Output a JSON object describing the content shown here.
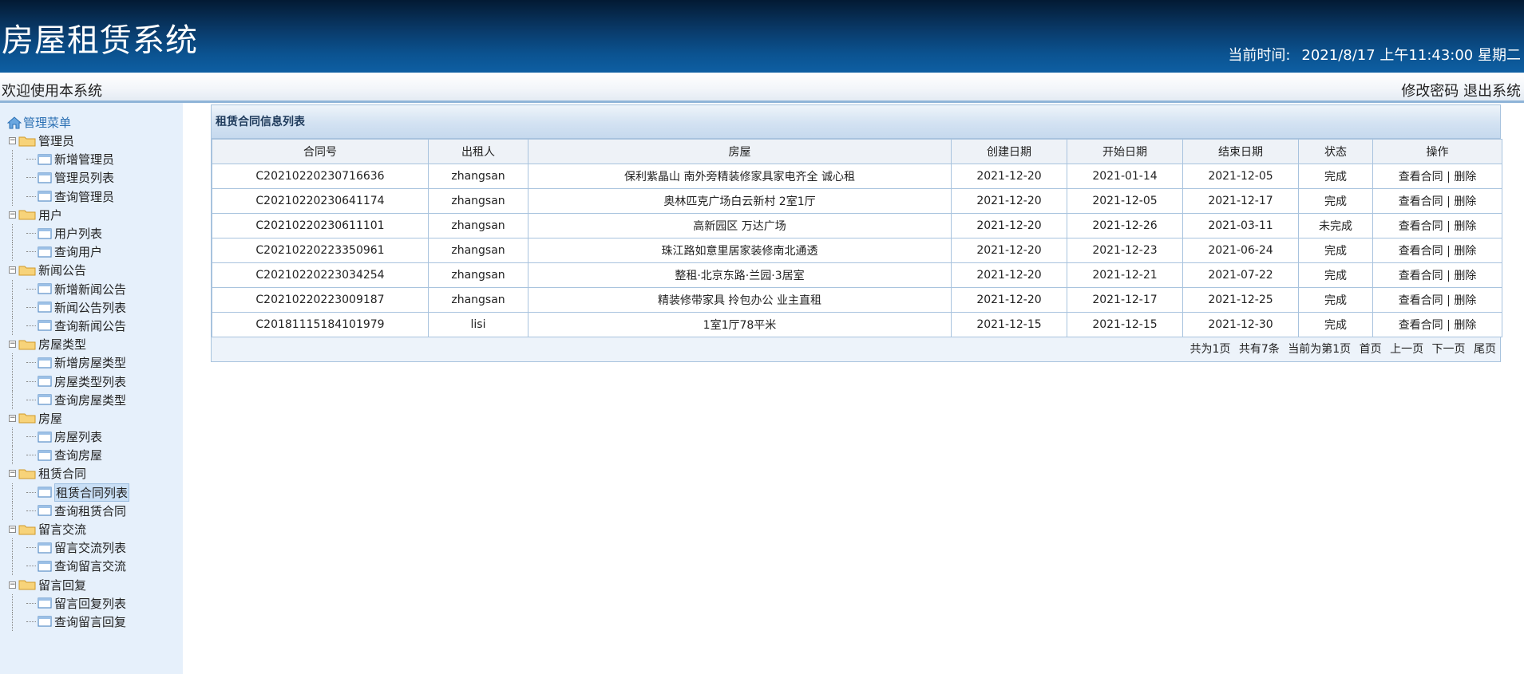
{
  "header": {
    "title": "房屋租赁系统",
    "clock_label": "当前时间:",
    "clock_value": "2021/8/17 上午11:43:00 星期二"
  },
  "bar": {
    "welcome": "欢迎使用本系统",
    "change_password": "修改密码",
    "logout": "退出系统"
  },
  "sidebar": {
    "root": "管理菜单",
    "groups": [
      {
        "label": "管理员",
        "items": [
          "新增管理员",
          "管理员列表",
          "查询管理员"
        ]
      },
      {
        "label": "用户",
        "items": [
          "用户列表",
          "查询用户"
        ]
      },
      {
        "label": "新闻公告",
        "items": [
          "新增新闻公告",
          "新闻公告列表",
          "查询新闻公告"
        ]
      },
      {
        "label": "房屋类型",
        "items": [
          "新增房屋类型",
          "房屋类型列表",
          "查询房屋类型"
        ]
      },
      {
        "label": "房屋",
        "items": [
          "房屋列表",
          "查询房屋"
        ]
      },
      {
        "label": "租赁合同",
        "items": [
          "租赁合同列表",
          "查询租赁合同"
        ]
      },
      {
        "label": "留言交流",
        "items": [
          "留言交流列表",
          "查询留言交流"
        ]
      },
      {
        "label": "留言回复",
        "items": [
          "留言回复列表",
          "查询留言回复"
        ]
      }
    ],
    "selected": "租赁合同列表"
  },
  "panel": {
    "title": "租赁合同信息列表",
    "columns": [
      "合同号",
      "出租人",
      "房屋",
      "创建日期",
      "开始日期",
      "结束日期",
      "状态",
      "操作"
    ],
    "rows": [
      [
        "C20210220230716636",
        "zhangsan",
        "保利紫晶山 南外旁精装修家具家电齐全 诚心租",
        "2021-12-20",
        "2021-01-14",
        "2021-12-05",
        "完成"
      ],
      [
        "C20210220230641174",
        "zhangsan",
        "奥林匹克广场白云新村 2室1厅",
        "2021-12-20",
        "2021-12-05",
        "2021-12-17",
        "完成"
      ],
      [
        "C20210220230611101",
        "zhangsan",
        "高新园区 万达广场",
        "2021-12-20",
        "2021-12-26",
        "2021-03-11",
        "未完成"
      ],
      [
        "C20210220223350961",
        "zhangsan",
        "珠江路如意里居家装修南北通透",
        "2021-12-20",
        "2021-12-23",
        "2021-06-24",
        "完成"
      ],
      [
        "C20210220223034254",
        "zhangsan",
        "整租·北京东路·兰园·3居室",
        "2021-12-20",
        "2021-12-21",
        "2021-07-22",
        "完成"
      ],
      [
        "C20210220223009187",
        "zhangsan",
        "精装修带家具 拎包办公 业主直租",
        "2021-12-20",
        "2021-12-17",
        "2021-12-25",
        "完成"
      ],
      [
        "C20181115184101979",
        "lisi",
        "1室1厅78平米",
        "2021-12-15",
        "2021-12-15",
        "2021-12-30",
        "完成"
      ]
    ],
    "op_view": "查看合同",
    "op_sep": "|",
    "op_delete": "删除",
    "pager": {
      "total_pages": "共为1页",
      "total_items": "共有7条",
      "current": "当前为第1页",
      "first": "首页",
      "prev": "上一页",
      "next": "下一页",
      "last": "尾页"
    }
  }
}
